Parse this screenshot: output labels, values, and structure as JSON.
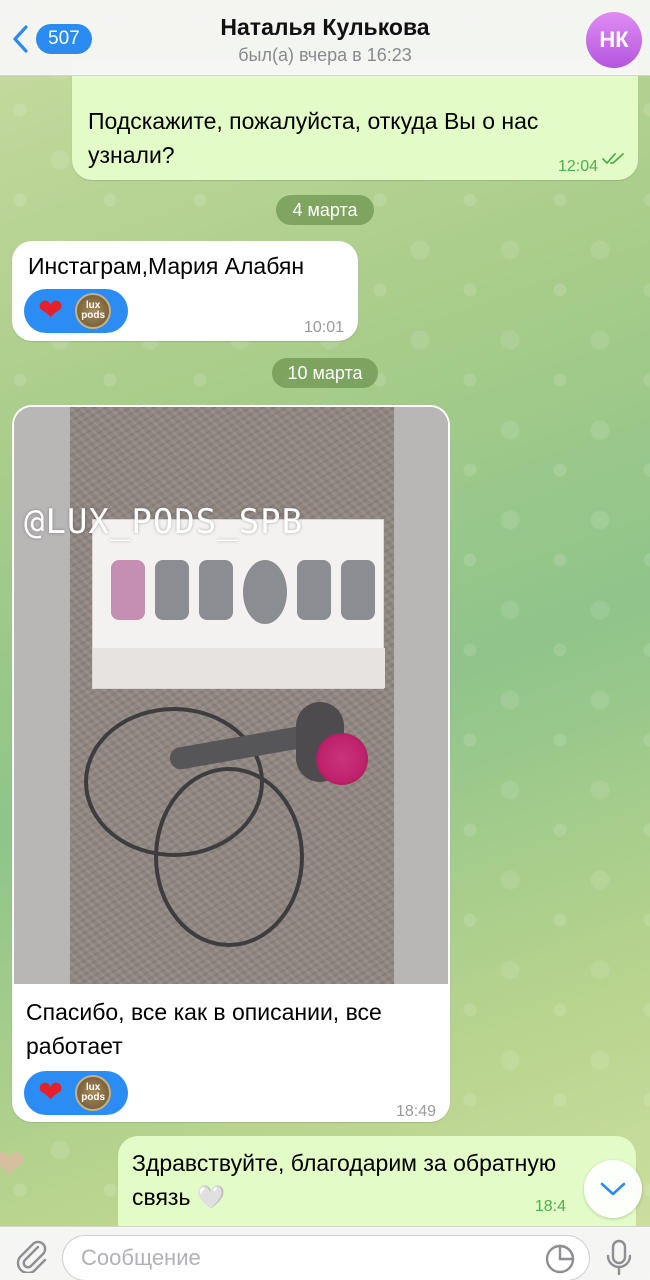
{
  "header": {
    "back_count": "507",
    "title": "Наталья Кулькова",
    "status": "был(а) вчера в 16:23",
    "avatar_initials": "НК"
  },
  "messages": [
    {
      "id": "m1",
      "direction": "out",
      "text_line1": "Подскажите, пожалуйста, откуда Вы о нас",
      "text_line2": "узнали?",
      "time": "12:04",
      "read": true
    },
    {
      "id": "d1",
      "type": "date",
      "text": "4 марта"
    },
    {
      "id": "m2",
      "direction": "in",
      "text": "Инстаграм,Мария Алабян",
      "time": "10:01",
      "reactions": [
        "heart",
        "lux-pods-logo"
      ]
    },
    {
      "id": "d2",
      "type": "date",
      "text": "10 марта"
    },
    {
      "id": "m3",
      "direction": "in",
      "photo_watermark": "@LUX_PODS_SPB",
      "text_line1": "Спасибо, все как в описании, все",
      "text_line2": "работает",
      "time": "18:49",
      "reactions": [
        "heart",
        "lux-pods-logo"
      ]
    },
    {
      "id": "m4",
      "direction": "out",
      "text_line1": "Здравствуйте, благодарим за обратную",
      "text_line2": "связь 🤍",
      "time": "18:4"
    }
  ],
  "reaction_logo_text": "lux pods",
  "input": {
    "placeholder": "Сообщение"
  },
  "colors": {
    "accent": "#2a8cf0",
    "outgoing_bubble": "#e2fbc7",
    "incoming_bubble": "#ffffff",
    "read_check": "#4fae4e",
    "avatar": "#c46ae8"
  }
}
